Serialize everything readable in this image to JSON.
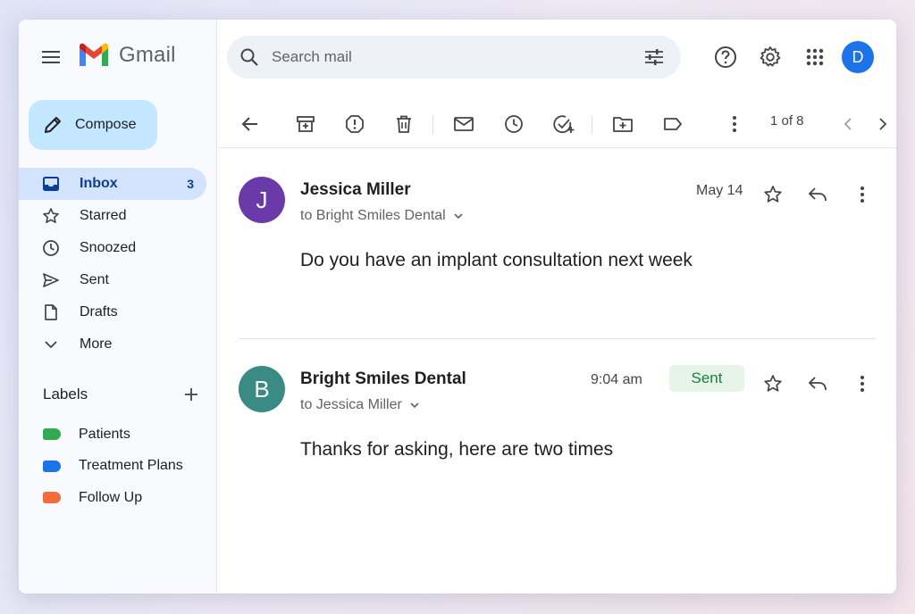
{
  "app": {
    "name": "Gmail"
  },
  "colors": {
    "accent": "#c2e7ff",
    "inbox_active": "#d3e3fd",
    "avatar_user": "#1a73e8",
    "avatar_jessica": "#6a3aa8",
    "avatar_bright": "#3a8a85",
    "sent_badge_bg": "#e6f4ea",
    "sent_badge_fg": "#188038"
  },
  "sidebar": {
    "compose_label": "Compose",
    "nav": [
      {
        "label": "Inbox",
        "icon": "inbox-icon",
        "count": "3",
        "active": true
      },
      {
        "label": "Starred",
        "icon": "star-icon"
      },
      {
        "label": "Snoozed",
        "icon": "clock-icon"
      },
      {
        "label": "Sent",
        "icon": "send-icon"
      },
      {
        "label": "Drafts",
        "icon": "draft-icon"
      },
      {
        "label": "More",
        "icon": "chevron-down-icon"
      }
    ],
    "labels_title": "Labels",
    "labels": [
      {
        "name": "Patients",
        "color": "#34a853"
      },
      {
        "name": "Treatment Plans",
        "color": "#1a73e8"
      },
      {
        "name": "Follow Up",
        "color": "#f26b3a"
      }
    ]
  },
  "header": {
    "search_placeholder": "Search mail",
    "avatar_initial": "D"
  },
  "toolbar": {
    "pager": "1 of 8"
  },
  "thread": {
    "messages": [
      {
        "initial": "J",
        "sender": "Jessica Miller",
        "recipient": "to Bright Smiles Dental",
        "date": "May 14",
        "body": "Do you have an implant consultation next week"
      },
      {
        "initial": "B",
        "sender": "Bright Smiles Dental",
        "recipient": "to Jessica Miller",
        "date": "9:04 am",
        "badge": "Sent",
        "body": "Thanks for asking, here are two times"
      }
    ]
  }
}
